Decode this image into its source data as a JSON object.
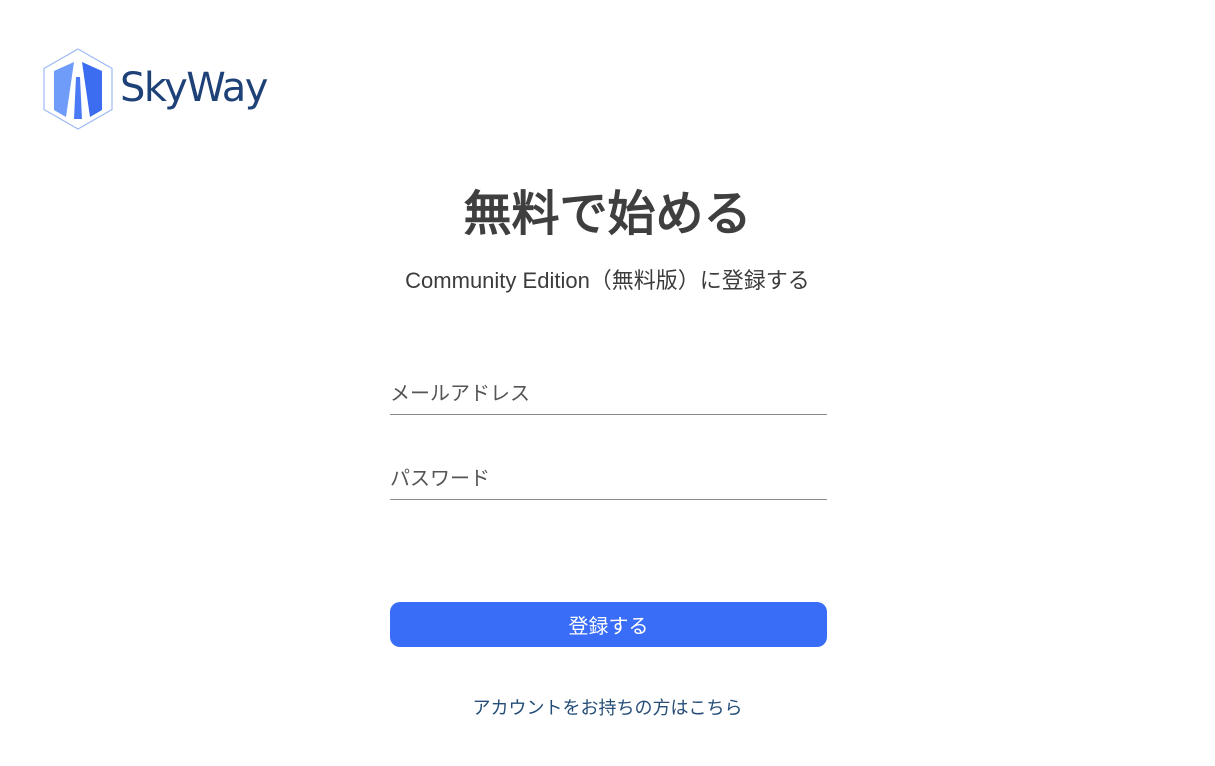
{
  "logo": {
    "text": "SkyWay",
    "icon": "skyway-hexagon-logo-icon"
  },
  "heading": {
    "title": "無料で始める",
    "subtitle": "Community Edition（無料版）に登録する"
  },
  "form": {
    "email_placeholder": "メールアドレス",
    "email_value": "",
    "password_placeholder": "パスワード",
    "password_value": "",
    "submit_label": "登録する"
  },
  "footer": {
    "login_link": "アカウントをお持ちの方はこちら"
  },
  "colors": {
    "brand": "#1e4178",
    "button": "#3a6df7",
    "link": "#264e78",
    "heading": "#3f3f3f"
  }
}
